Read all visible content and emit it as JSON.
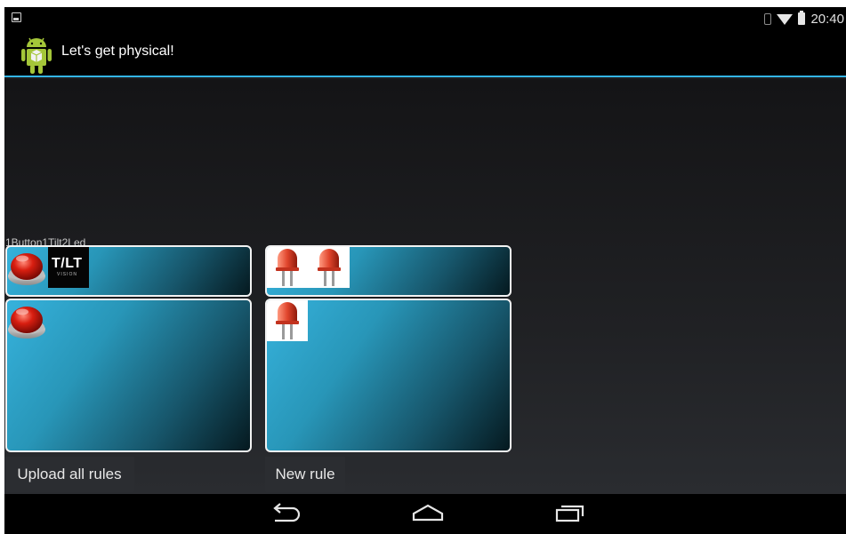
{
  "status_bar": {
    "time": "20:40"
  },
  "app": {
    "title": "Let's get physical!"
  },
  "config": {
    "label": "1Button1Tilt2Led"
  },
  "rules": [
    {
      "conditions": [
        "red-button-icon",
        "tilt-vision-logo"
      ],
      "actions": [
        "led-icon",
        "led-icon"
      ]
    },
    {
      "conditions": [
        "red-button-icon"
      ],
      "actions": [
        "led-icon"
      ]
    }
  ],
  "tilt_logo": {
    "text": "T/LT",
    "subtext": "VISION"
  },
  "buttons": {
    "upload": "Upload all rules",
    "new_rule": "New rule"
  },
  "colors": {
    "accent": "#33b5e5",
    "android_green": "#a4c639",
    "led_red": "#e0452c"
  }
}
